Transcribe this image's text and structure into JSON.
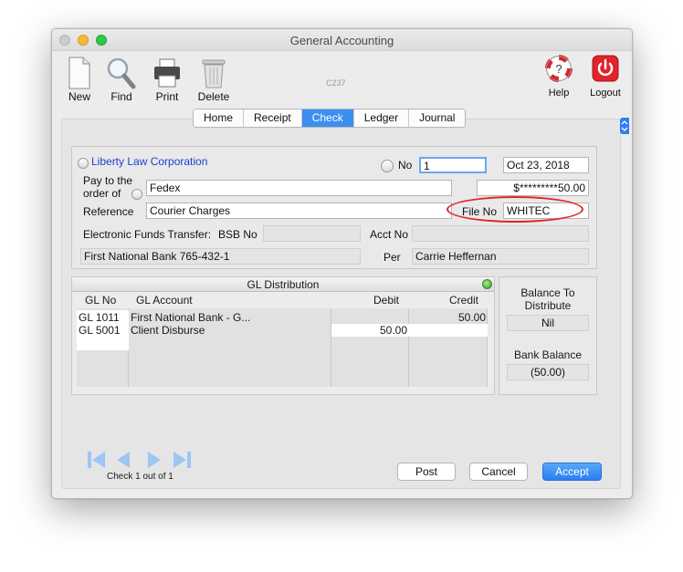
{
  "window": {
    "title": "General Accounting",
    "code": "C237"
  },
  "toolbar": {
    "new": "New",
    "find": "Find",
    "print": "Print",
    "delete": "Delete",
    "help": "Help",
    "logout": "Logout"
  },
  "tabs": [
    "Home",
    "Receipt",
    "Check",
    "Ledger",
    "Journal"
  ],
  "active_tab": "Check",
  "check": {
    "payer": "Liberty Law Corporation",
    "no_label": "No",
    "no_value": "1",
    "date": "Oct 23, 2018",
    "pay_to_label_1": "Pay to the",
    "pay_to_label_2": "order of",
    "payee": "Fedex",
    "amount": "$*********50.00",
    "reference_label": "Reference",
    "reference": "Courier Charges",
    "file_no_label": "File No",
    "file_no": "WHITEC",
    "eft_label": "Electronic Funds Transfer:",
    "bsb_label": "BSB No",
    "bsb_value": "",
    "acct_label": "Acct No",
    "acct_value": "",
    "bank": "First National Bank 765-432-1",
    "per_label": "Per",
    "per_value": "Carrie Heffernan"
  },
  "gl": {
    "title": "GL Distribution",
    "headers": {
      "gl_no": "GL No",
      "account": "GL Account",
      "debit": "Debit",
      "credit": "Credit"
    },
    "rows": [
      {
        "gl_no": "GL 1011",
        "account": "First National Bank - G...",
        "debit": "",
        "credit": "50.00"
      },
      {
        "gl_no": "GL 5001",
        "account": "Client Disburse",
        "debit": "50.00",
        "credit": ""
      }
    ]
  },
  "balance": {
    "to_distribute_label": "Balance To Distribute",
    "to_distribute_value": "Nil",
    "bank_label": "Bank Balance",
    "bank_value": "(50.00)"
  },
  "nav": {
    "status": "Check 1 out of 1"
  },
  "buttons": {
    "post": "Post",
    "cancel": "Cancel",
    "accept": "Accept"
  },
  "colors": {
    "accent": "#3b8ff0",
    "highlight_circle": "#e0262a",
    "link_blue": "#1a3fd1"
  }
}
